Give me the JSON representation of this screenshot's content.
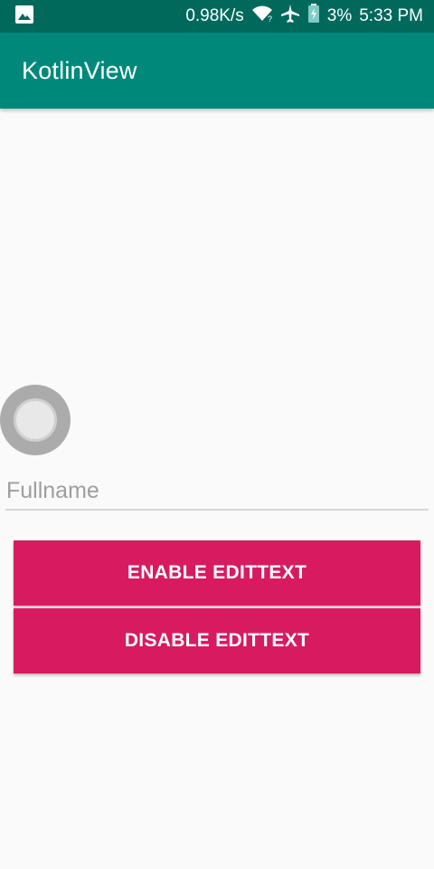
{
  "status_bar": {
    "network_speed": "0.98K/s",
    "battery_percent": "3%",
    "time": "5:33 PM",
    "icons": [
      "image-icon",
      "wifi-icon",
      "airplane-icon",
      "battery-charging-icon"
    ]
  },
  "app_bar": {
    "title": "KotlinView"
  },
  "form": {
    "fullname_placeholder": "Fullname",
    "fullname_value": ""
  },
  "buttons": {
    "enable_label": "ENABLE EDITTEXT",
    "disable_label": "DISABLE EDITTEXT"
  },
  "colors": {
    "status_bar": "#00695c",
    "app_bar": "#00897b",
    "button": "#d81b60",
    "background": "#fafafa"
  }
}
